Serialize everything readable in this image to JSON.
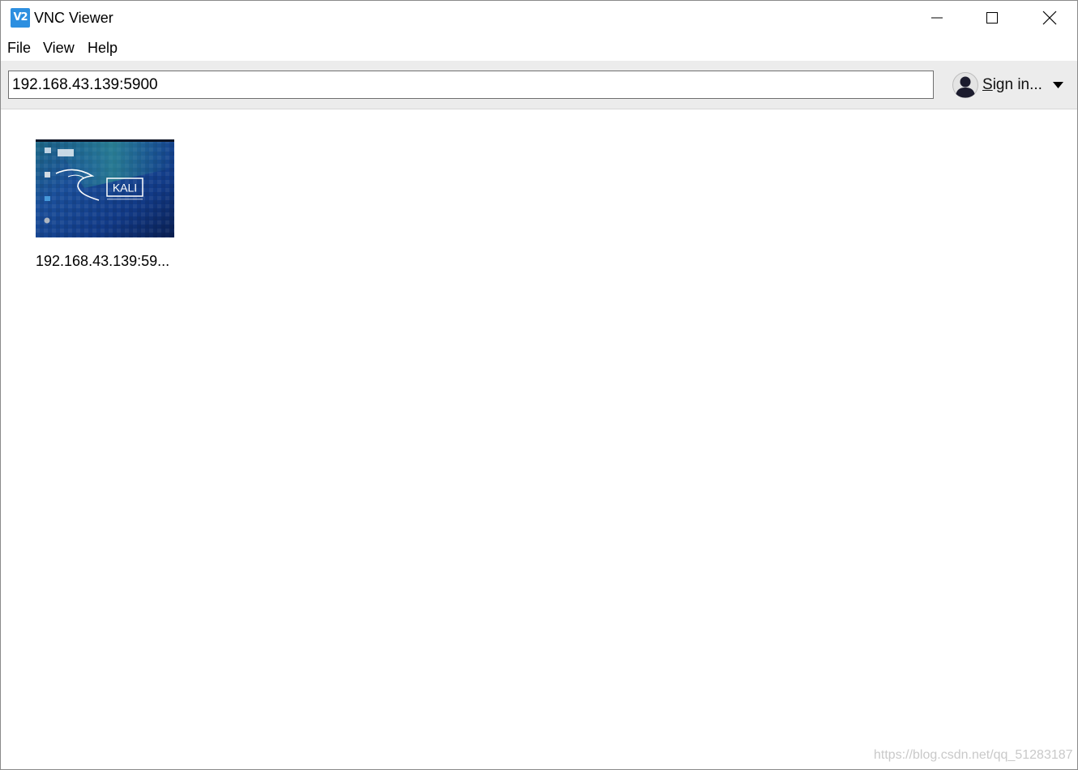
{
  "window": {
    "title": "VNC Viewer",
    "app_icon_text": "V2",
    "accent_color": "#2d8fe0",
    "controls": [
      "minimize-icon",
      "maximize-icon",
      "close-icon"
    ]
  },
  "menu": {
    "file": "File",
    "view": "View",
    "help": "Help"
  },
  "toolbar": {
    "address_value": "192.168.43.139:5900",
    "signin_first": "S",
    "signin_rest": "ign in...",
    "avatar_icon": "user-avatar-icon",
    "dropdown_icon": "caret-down-icon"
  },
  "connections": [
    {
      "label": "192.168.43.139:59...",
      "thumbnail_text": "KALI"
    }
  ],
  "watermark": "https://blog.csdn.net/qq_51283187"
}
